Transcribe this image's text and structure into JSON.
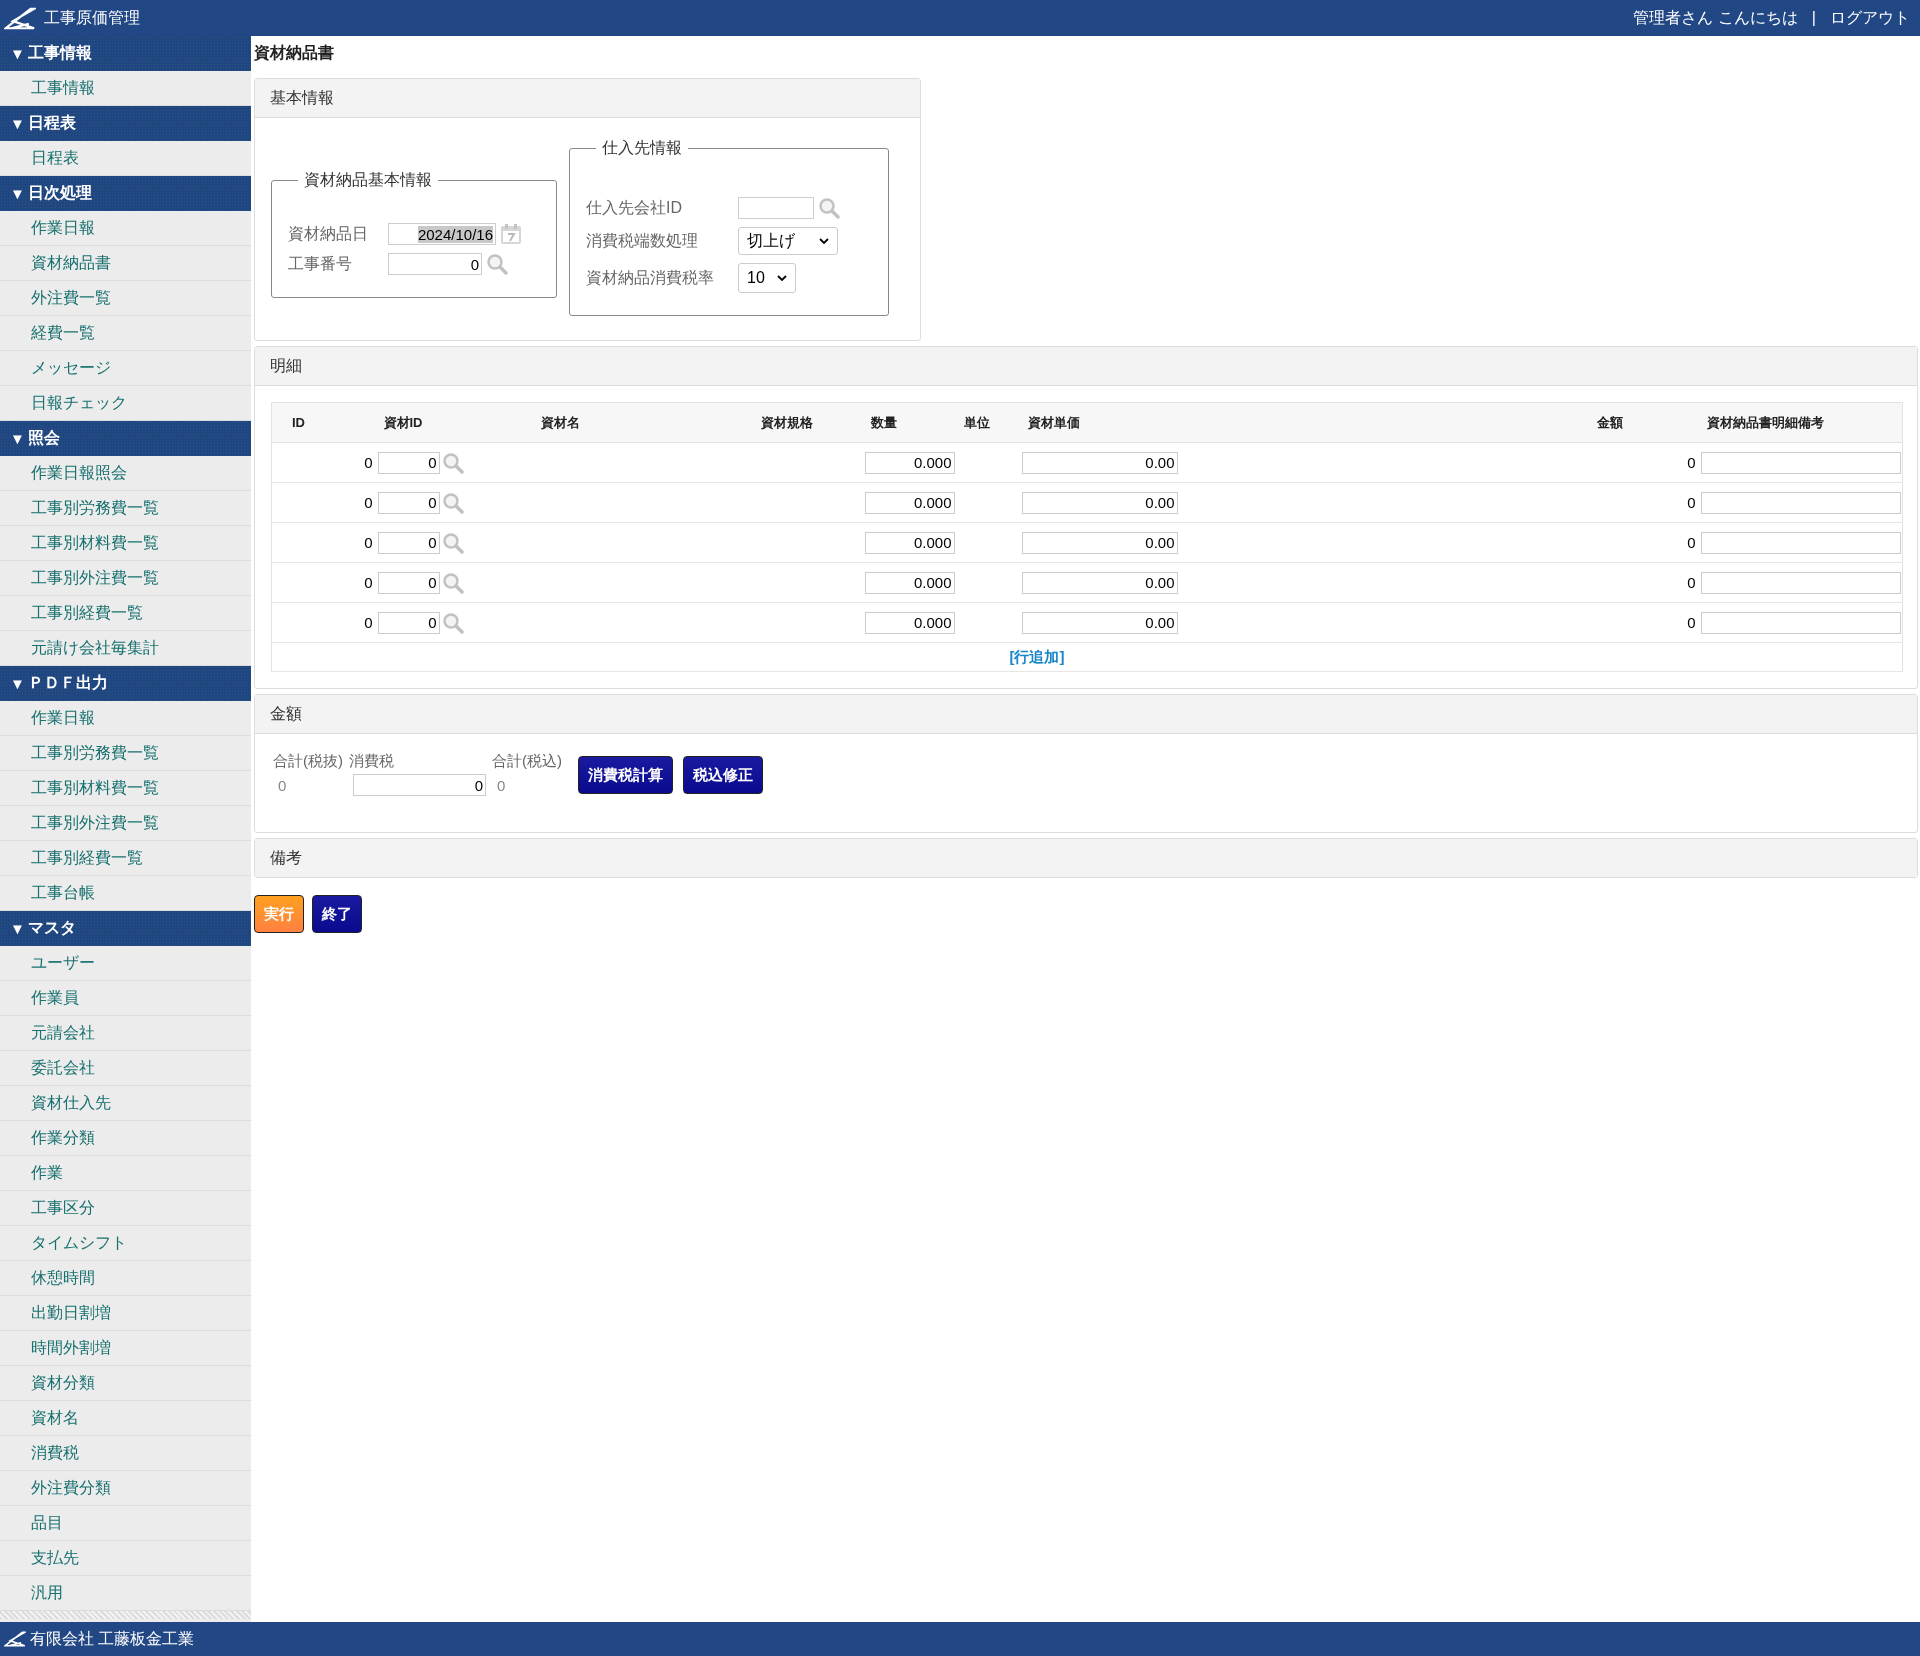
{
  "app_bar": {
    "title": "工事原価管理",
    "greeting": "管理者さん こんにちは",
    "separator": "|",
    "logout": "ログアウト"
  },
  "sidebar": {
    "groups": [
      {
        "label": "工事情報",
        "marker": "▼",
        "expanded": true,
        "items": [
          "工事情報"
        ]
      },
      {
        "label": "日程表",
        "marker": "▼",
        "expanded": true,
        "items": [
          "日程表"
        ]
      },
      {
        "label": "日次処理",
        "marker": "▼",
        "expanded": true,
        "items": [
          "作業日報",
          "資材納品書",
          "外注費一覧",
          "経費一覧",
          "メッセージ",
          "日報チェック"
        ]
      },
      {
        "label": "照会",
        "marker": "▼",
        "expanded": true,
        "items": [
          "作業日報照会",
          "工事別労務費一覧",
          "工事別材料費一覧",
          "工事別外注費一覧",
          "工事別経費一覧",
          "元請け会社毎集計"
        ]
      },
      {
        "label": "ＰＤＦ出力",
        "marker": "▼",
        "expanded": true,
        "items": [
          "作業日報",
          "工事別労務費一覧",
          "工事別材料費一覧",
          "工事別外注費一覧",
          "工事別経費一覧",
          "工事台帳"
        ]
      },
      {
        "label": "マスタ",
        "marker": "▼",
        "expanded": true,
        "items": [
          "ユーザー",
          "作業員",
          "元請会社",
          "委託会社",
          "資材仕入先",
          "作業分類",
          "作業",
          "工事区分",
          "タイムシフト",
          "休憩時間",
          "出勤日割増",
          "時間外割増",
          "資材分類",
          "資材名",
          "消費税",
          "外注費分類",
          "品目",
          "支払先",
          "汎用"
        ]
      }
    ]
  },
  "page_title": "資材納品書",
  "basic_info": {
    "title": "基本情報",
    "delivery": {
      "legend": "資材納品基本情報",
      "date_label": "資材納品日",
      "date_value": "2024/10/16",
      "date_selected": true,
      "job_label": "工事番号",
      "job_value": "0"
    },
    "supplier": {
      "legend": "仕入先情報",
      "id_label": "仕入先会社ID",
      "rounding_label": "消費税端数処理",
      "rounding_value": "切上げ",
      "rate_label": "資材納品消費税率",
      "rate_value": "10"
    }
  },
  "details": {
    "title": "明細",
    "columns": [
      "ID",
      "資材ID",
      "資材名",
      "資材規格",
      "数量",
      "単位",
      "資材単価",
      "金額",
      "資材納品書明細備考"
    ],
    "rows": [
      {
        "id": "0",
        "material_id": "0",
        "quantity": "0.000",
        "unit_price": "0.00",
        "amount": "0"
      },
      {
        "id": "0",
        "material_id": "0",
        "quantity": "0.000",
        "unit_price": "0.00",
        "amount": "0"
      },
      {
        "id": "0",
        "material_id": "0",
        "quantity": "0.000",
        "unit_price": "0.00",
        "amount": "0"
      },
      {
        "id": "0",
        "material_id": "0",
        "quantity": "0.000",
        "unit_price": "0.00",
        "amount": "0"
      },
      {
        "id": "0",
        "material_id": "0",
        "quantity": "0.000",
        "unit_price": "0.00",
        "amount": "0"
      }
    ],
    "add_row": "[行追加]"
  },
  "amounts": {
    "title": "金額",
    "subtotal_label": "合計(税抜)",
    "subtotal": "0",
    "tax_label": "消費税",
    "tax": "0",
    "total_label": "合計(税込)",
    "total": "0",
    "buttons": [
      "消費税計算",
      "税込修正"
    ]
  },
  "remarks": {
    "title": "備考"
  },
  "actions": [
    {
      "label": "実行",
      "kind": "primary"
    },
    {
      "label": "終了",
      "kind": "secondary"
    }
  ],
  "footer": {
    "company": "有限会社 工藤板金工業"
  }
}
